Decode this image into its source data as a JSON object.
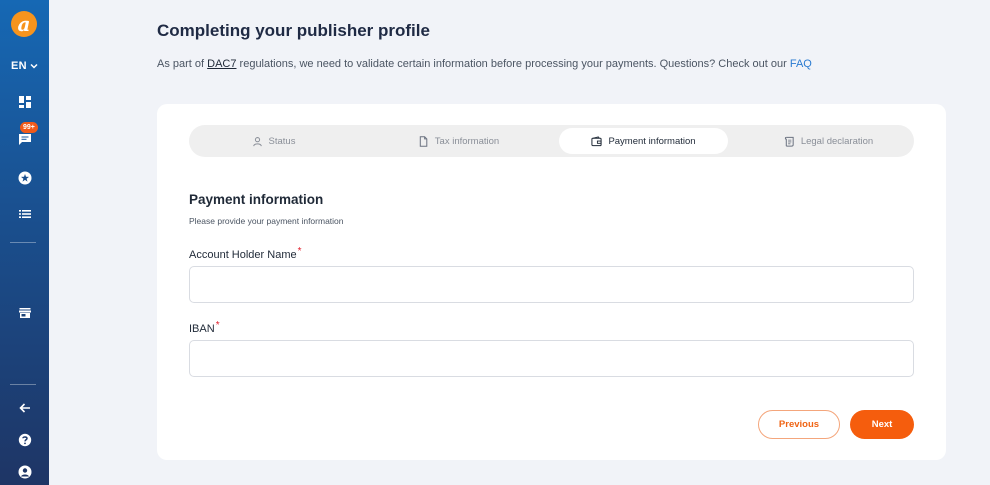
{
  "sidebar": {
    "logo_letter": "a",
    "language": "EN",
    "notification_badge": "99+",
    "items": [
      {
        "icon": "dashboard-icon"
      },
      {
        "icon": "chat-icon"
      },
      {
        "icon": "star-icon"
      },
      {
        "icon": "list-icon"
      },
      {
        "icon": "store-icon"
      },
      {
        "icon": "arrow-left-icon"
      },
      {
        "icon": "help-icon"
      },
      {
        "icon": "account-icon"
      }
    ]
  },
  "header": {
    "title": "Completing your publisher profile",
    "subtitle_before": "As part of ",
    "subtitle_link": "DAC7",
    "subtitle_middle": " regulations, we need to validate certain information before processing your payments. Questions? Check out our ",
    "faq_link": "FAQ"
  },
  "stepper": {
    "steps": [
      {
        "label": "Status",
        "icon": "user-icon",
        "active": false
      },
      {
        "label": "Tax information",
        "icon": "document-icon",
        "active": false
      },
      {
        "label": "Payment information",
        "icon": "wallet-icon",
        "active": true
      },
      {
        "label": "Legal declaration",
        "icon": "scroll-icon",
        "active": false
      }
    ]
  },
  "form": {
    "title": "Payment information",
    "subtitle": "Please provide your payment information",
    "fields": [
      {
        "label": "Account Holder Name",
        "required_mark": "*",
        "value": "",
        "placeholder": ""
      },
      {
        "label": "IBAN",
        "required_mark": "*",
        "value": "",
        "placeholder": ""
      }
    ]
  },
  "actions": {
    "previous_label": "Previous",
    "next_label": "Next"
  },
  "colors": {
    "accent": "#f55d0d",
    "link": "#2a7bd1",
    "sidebar_top": "#1668b4",
    "sidebar_bottom": "#1e3565",
    "required": "#e11d2a"
  }
}
